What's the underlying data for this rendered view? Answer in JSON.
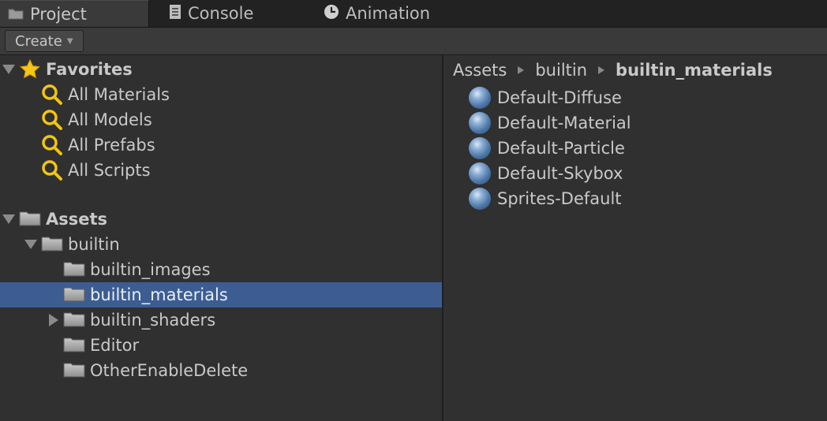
{
  "tabs": [
    {
      "label": "Project",
      "icon": "folder-icon",
      "active": true
    },
    {
      "label": "Console",
      "icon": "console-icon",
      "active": false
    },
    {
      "label": "Animation",
      "icon": "clock-icon",
      "active": false
    }
  ],
  "toolbar": {
    "create_label": "Create"
  },
  "favorites": {
    "title": "Favorites",
    "items": [
      {
        "label": "All Materials"
      },
      {
        "label": "All Models"
      },
      {
        "label": "All Prefabs"
      },
      {
        "label": "All Scripts"
      }
    ]
  },
  "assets": {
    "title": "Assets",
    "builtin": {
      "label": "builtin",
      "children": [
        {
          "label": "builtin_images"
        },
        {
          "label": "builtin_materials",
          "selected": true
        },
        {
          "label": "builtin_shaders"
        },
        {
          "label": "Editor"
        },
        {
          "label": "OtherEnableDelete"
        }
      ]
    }
  },
  "breadcrumb": [
    "Assets",
    "builtin",
    "builtin_materials"
  ],
  "materials": [
    {
      "label": "Default-Diffuse"
    },
    {
      "label": "Default-Material"
    },
    {
      "label": "Default-Particle"
    },
    {
      "label": "Default-Skybox"
    },
    {
      "label": "Sprites-Default"
    }
  ],
  "colors": {
    "selection": "#3d5d92",
    "background": "#303030",
    "star": "#f5c518",
    "search": "#f2c413"
  }
}
